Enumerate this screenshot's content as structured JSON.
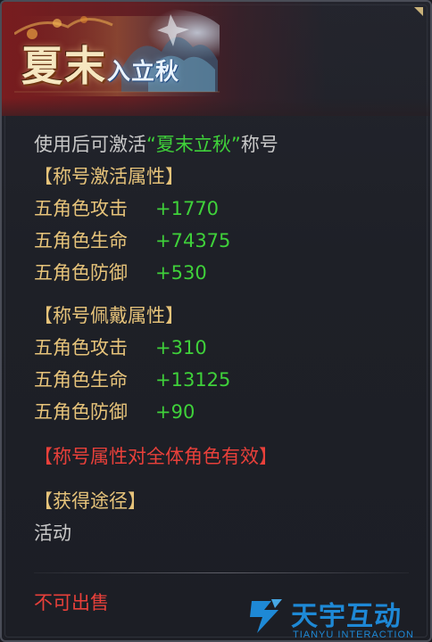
{
  "header": {
    "title_main": "夏末",
    "title_sub": "入立秋"
  },
  "body": {
    "usage": {
      "prefix": "使用后可激活",
      "title_name": "“夏末立秋”",
      "suffix": "称号"
    },
    "activation_section": {
      "heading": "【称号激活属性】",
      "stats": [
        {
          "name": "五角色攻击",
          "value": "+1770"
        },
        {
          "name": "五角色生命",
          "value": "+74375"
        },
        {
          "name": "五角色防御",
          "value": "+530"
        }
      ]
    },
    "wear_section": {
      "heading": "【称号佩戴属性】",
      "stats": [
        {
          "name": "五角色攻击",
          "value": "+310"
        },
        {
          "name": "五角色生命",
          "value": "+13125"
        },
        {
          "name": "五角色防御",
          "value": "+90"
        }
      ]
    },
    "note": "【称号属性对全体角色有效】",
    "source_heading": "【获得途径】",
    "source_value": "活动",
    "sell_status": "不可出售"
  },
  "watermark": {
    "cn": "天宇互动",
    "en": "TIANYU INTERACTION"
  },
  "colors": {
    "gold": "#e6c37a",
    "green": "#3fd13a",
    "red": "#e8403a",
    "grey": "#c8c8c8",
    "banner_red": "#7d1c1e",
    "watermark_blue": "#1f8fe0"
  },
  "icons": {
    "corner": "triangle-corner-icon",
    "banner_art": "autumn-landscape-art",
    "watermark_logo": "tianyu-logo-icon"
  }
}
